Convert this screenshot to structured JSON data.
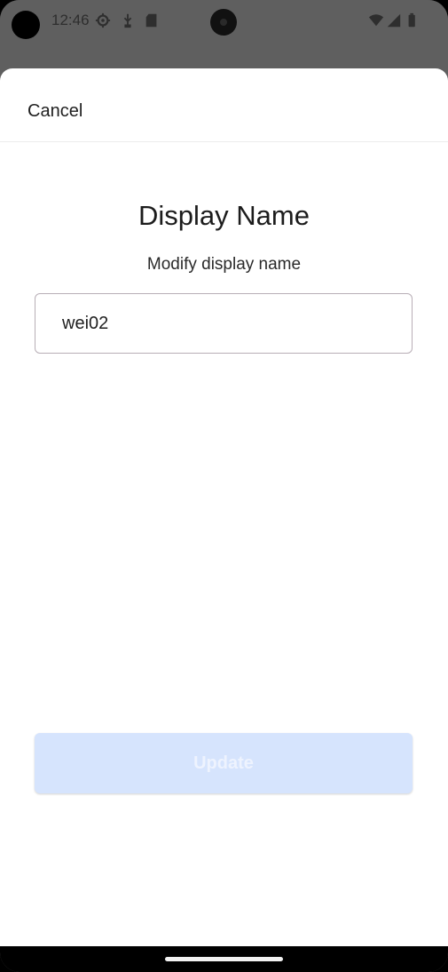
{
  "status_bar": {
    "time": "12:46",
    "left_icons": [
      "settings-icon",
      "usb-icon",
      "sd-card-icon"
    ],
    "right_icons": [
      "wifi-icon",
      "signal-icon",
      "battery-icon"
    ]
  },
  "header": {
    "cancel_label": "Cancel"
  },
  "main": {
    "title": "Display Name",
    "subtitle": "Modify display name",
    "name_field": {
      "value": "wei02"
    },
    "update_label": "Update",
    "update_enabled": false
  },
  "colors": {
    "update_button_bg": "#d6e4fd",
    "scrim": "#5f5f5f"
  }
}
